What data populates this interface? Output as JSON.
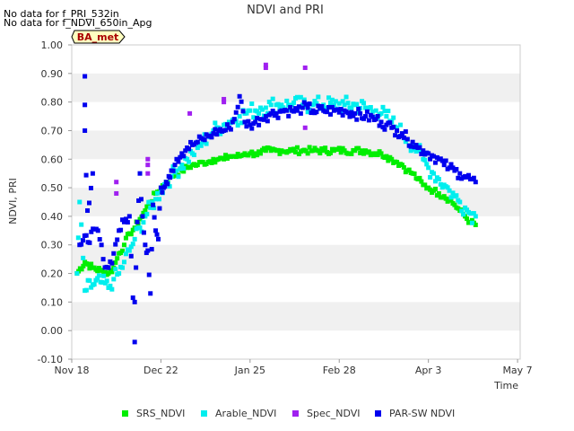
{
  "nodata_notes": [
    "No data for f_PRI_532in",
    "No data for f_NDVI_650in_Apg"
  ],
  "site_badge": "BA_met",
  "colors": {
    "SRS_NDVI": "#00ee00",
    "Arable_NDVI": "#00eeee",
    "Spec_NDVI": "#a020f0",
    "PAR-SW NDVI": "#0000ee",
    "band": "#f0f0f0",
    "badge_fill": "#ffffc0",
    "badge_text": "#aa0000"
  },
  "chart_data": {
    "type": "scatter",
    "title": "NDVI and PRI",
    "xlabel": "Time",
    "ylabel": "NDVI, PRI",
    "x_ticks": [
      "Nov 18",
      "Dec 22",
      "Jan 25",
      "Feb 28",
      "Apr 3",
      "May 7"
    ],
    "xlim_days": [
      0,
      171
    ],
    "ylim": [
      -0.1,
      1.0
    ],
    "y_ticks": [
      "-0.10",
      "0.00",
      "0.10",
      "0.20",
      "0.30",
      "0.40",
      "0.50",
      "0.60",
      "0.70",
      "0.80",
      "0.90",
      "1.00"
    ],
    "grid": "alternating horizontal bands",
    "legend_position": "bottom",
    "series": [
      {
        "name": "SRS_NDVI",
        "points": [
          [
            2,
            0.2
          ],
          [
            5,
            0.24
          ],
          [
            8,
            0.22
          ],
          [
            11,
            0.21
          ],
          [
            14,
            0.2
          ],
          [
            16,
            0.22
          ],
          [
            18,
            0.27
          ],
          [
            20,
            0.3
          ],
          [
            22,
            0.34
          ],
          [
            24,
            0.36
          ],
          [
            26,
            0.39
          ],
          [
            28,
            0.42
          ],
          [
            30,
            0.45
          ],
          [
            32,
            0.48
          ],
          [
            34,
            0.5
          ],
          [
            36,
            0.52
          ],
          [
            38,
            0.54
          ],
          [
            40,
            0.55
          ],
          [
            42,
            0.56
          ],
          [
            44,
            0.57
          ],
          [
            46,
            0.58
          ],
          [
            48,
            0.58
          ],
          [
            50,
            0.59
          ],
          [
            52,
            0.59
          ],
          [
            54,
            0.6
          ],
          [
            56,
            0.6
          ],
          [
            58,
            0.6
          ],
          [
            60,
            0.61
          ],
          [
            62,
            0.61
          ],
          [
            64,
            0.61
          ],
          [
            66,
            0.62
          ],
          [
            68,
            0.62
          ],
          [
            70,
            0.62
          ],
          [
            72,
            0.62
          ],
          [
            74,
            0.63
          ],
          [
            76,
            0.63
          ],
          [
            78,
            0.63
          ],
          [
            80,
            0.63
          ],
          [
            84,
            0.63
          ],
          [
            88,
            0.63
          ],
          [
            92,
            0.63
          ],
          [
            96,
            0.63
          ],
          [
            100,
            0.63
          ],
          [
            104,
            0.63
          ],
          [
            108,
            0.63
          ],
          [
            112,
            0.63
          ],
          [
            116,
            0.62
          ],
          [
            118,
            0.62
          ],
          [
            120,
            0.61
          ],
          [
            122,
            0.6
          ],
          [
            124,
            0.59
          ],
          [
            126,
            0.58
          ],
          [
            128,
            0.56
          ],
          [
            130,
            0.55
          ],
          [
            132,
            0.53
          ],
          [
            134,
            0.51
          ],
          [
            136,
            0.5
          ],
          [
            138,
            0.49
          ],
          [
            140,
            0.48
          ],
          [
            142,
            0.47
          ],
          [
            144,
            0.46
          ],
          [
            146,
            0.44
          ],
          [
            148,
            0.42
          ],
          [
            150,
            0.4
          ],
          [
            152,
            0.38
          ],
          [
            154,
            0.37
          ]
        ]
      },
      {
        "name": "Arable_NDVI",
        "points": [
          [
            2,
            0.2
          ],
          [
            3,
            0.45
          ],
          [
            5,
            0.14
          ],
          [
            8,
            0.16
          ],
          [
            11,
            0.17
          ],
          [
            14,
            0.15
          ],
          [
            16,
            0.18
          ],
          [
            18,
            0.2
          ],
          [
            20,
            0.24
          ],
          [
            22,
            0.28
          ],
          [
            24,
            0.32
          ],
          [
            26,
            0.36
          ],
          [
            28,
            0.4
          ],
          [
            30,
            0.43
          ],
          [
            32,
            0.46
          ],
          [
            34,
            0.49
          ],
          [
            36,
            0.52
          ],
          [
            38,
            0.54
          ],
          [
            40,
            0.56
          ],
          [
            42,
            0.58
          ],
          [
            44,
            0.6
          ],
          [
            46,
            0.62
          ],
          [
            48,
            0.64
          ],
          [
            50,
            0.66
          ],
          [
            52,
            0.68
          ],
          [
            54,
            0.7
          ],
          [
            56,
            0.71
          ],
          [
            58,
            0.72
          ],
          [
            60,
            0.73
          ],
          [
            62,
            0.74
          ],
          [
            64,
            0.75
          ],
          [
            66,
            0.76
          ],
          [
            68,
            0.77
          ],
          [
            70,
            0.77
          ],
          [
            72,
            0.78
          ],
          [
            74,
            0.78
          ],
          [
            76,
            0.79
          ],
          [
            78,
            0.79
          ],
          [
            80,
            0.79
          ],
          [
            84,
            0.79
          ],
          [
            88,
            0.79
          ],
          [
            92,
            0.79
          ],
          [
            96,
            0.79
          ],
          [
            100,
            0.79
          ],
          [
            104,
            0.79
          ],
          [
            108,
            0.79
          ],
          [
            112,
            0.78
          ],
          [
            116,
            0.77
          ],
          [
            118,
            0.76
          ],
          [
            120,
            0.75
          ],
          [
            122,
            0.73
          ],
          [
            124,
            0.71
          ],
          [
            126,
            0.69
          ],
          [
            128,
            0.67
          ],
          [
            130,
            0.65
          ],
          [
            132,
            0.63
          ],
          [
            134,
            0.6
          ],
          [
            136,
            0.57
          ],
          [
            138,
            0.55
          ],
          [
            140,
            0.53
          ],
          [
            142,
            0.51
          ],
          [
            144,
            0.49
          ],
          [
            146,
            0.47
          ],
          [
            148,
            0.45
          ],
          [
            150,
            0.43
          ],
          [
            152,
            0.41
          ],
          [
            154,
            0.4
          ]
        ]
      },
      {
        "name": "Spec_NDVI",
        "points": [
          [
            17,
            0.52
          ],
          [
            17,
            0.48
          ],
          [
            29,
            0.6
          ],
          [
            29,
            0.58
          ],
          [
            29,
            0.55
          ],
          [
            45,
            0.76
          ],
          [
            58,
            0.81
          ],
          [
            58,
            0.8
          ],
          [
            74,
            0.92
          ],
          [
            74,
            0.93
          ],
          [
            89,
            0.92
          ],
          [
            89,
            0.71
          ]
        ]
      },
      {
        "name": "PAR-SW NDVI",
        "points": [
          [
            5,
            0.89
          ],
          [
            5,
            0.79
          ],
          [
            5,
            0.7
          ],
          [
            6,
            0.42
          ],
          [
            8,
            0.55
          ],
          [
            3,
            0.3
          ],
          [
            10,
            0.35
          ],
          [
            12,
            0.25
          ],
          [
            14,
            0.22
          ],
          [
            16,
            0.27
          ],
          [
            18,
            0.35
          ],
          [
            20,
            0.38
          ],
          [
            22,
            0.4
          ],
          [
            24,
            -0.04
          ],
          [
            24,
            0.1
          ],
          [
            25,
            0.38
          ],
          [
            26,
            0.55
          ],
          [
            27,
            0.4
          ],
          [
            28,
            0.3
          ],
          [
            29,
            0.28
          ],
          [
            30,
            0.13
          ],
          [
            31,
            0.44
          ],
          [
            32,
            0.35
          ],
          [
            33,
            0.32
          ],
          [
            34,
            0.5
          ],
          [
            35,
            0.5
          ],
          [
            36,
            0.52
          ],
          [
            37,
            0.54
          ],
          [
            38,
            0.56
          ],
          [
            40,
            0.6
          ],
          [
            42,
            0.62
          ],
          [
            44,
            0.64
          ],
          [
            46,
            0.65
          ],
          [
            48,
            0.66
          ],
          [
            50,
            0.67
          ],
          [
            52,
            0.68
          ],
          [
            54,
            0.69
          ],
          [
            56,
            0.7
          ],
          [
            58,
            0.7
          ],
          [
            60,
            0.71
          ],
          [
            62,
            0.74
          ],
          [
            64,
            0.82
          ],
          [
            66,
            0.73
          ],
          [
            68,
            0.72
          ],
          [
            70,
            0.73
          ],
          [
            72,
            0.74
          ],
          [
            74,
            0.75
          ],
          [
            76,
            0.76
          ],
          [
            78,
            0.76
          ],
          [
            80,
            0.77
          ],
          [
            82,
            0.77
          ],
          [
            84,
            0.77
          ],
          [
            86,
            0.77
          ],
          [
            88,
            0.78
          ],
          [
            90,
            0.78
          ],
          [
            92,
            0.77
          ],
          [
            96,
            0.77
          ],
          [
            100,
            0.77
          ],
          [
            104,
            0.77
          ],
          [
            108,
            0.76
          ],
          [
            112,
            0.75
          ],
          [
            116,
            0.74
          ],
          [
            118,
            0.73
          ],
          [
            120,
            0.72
          ],
          [
            122,
            0.71
          ],
          [
            124,
            0.7
          ],
          [
            126,
            0.69
          ],
          [
            128,
            0.67
          ],
          [
            130,
            0.66
          ],
          [
            132,
            0.64
          ],
          [
            134,
            0.63
          ],
          [
            136,
            0.62
          ],
          [
            138,
            0.61
          ],
          [
            140,
            0.6
          ],
          [
            142,
            0.58
          ],
          [
            144,
            0.57
          ],
          [
            146,
            0.56
          ],
          [
            148,
            0.55
          ],
          [
            150,
            0.54
          ],
          [
            152,
            0.53
          ],
          [
            154,
            0.52
          ]
        ]
      }
    ]
  }
}
